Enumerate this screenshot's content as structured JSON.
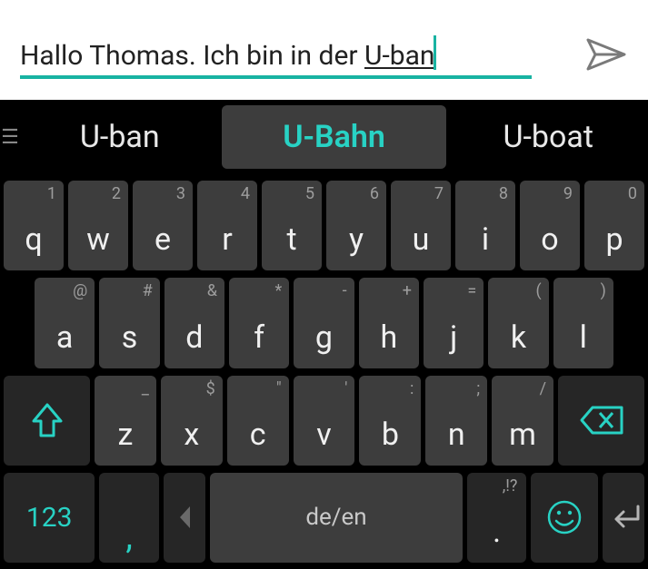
{
  "input": {
    "textBefore": "Hallo Thomas. Ich bin in der ",
    "textUnderline": "U-ban"
  },
  "suggestions": {
    "left": "U-ban",
    "center": "U-Bahn",
    "right": "U-boat"
  },
  "rows": {
    "r1": [
      {
        "main": "q",
        "sec": "1"
      },
      {
        "main": "w",
        "sec": "2"
      },
      {
        "main": "e",
        "sec": "3"
      },
      {
        "main": "r",
        "sec": "4"
      },
      {
        "main": "t",
        "sec": "5"
      },
      {
        "main": "y",
        "sec": "6"
      },
      {
        "main": "u",
        "sec": "7"
      },
      {
        "main": "i",
        "sec": "8"
      },
      {
        "main": "o",
        "sec": "9"
      },
      {
        "main": "p",
        "sec": "0"
      }
    ],
    "r2": [
      {
        "main": "a",
        "sec": "@"
      },
      {
        "main": "s",
        "sec": "#"
      },
      {
        "main": "d",
        "sec": "&"
      },
      {
        "main": "f",
        "sec": "*"
      },
      {
        "main": "g",
        "sec": "-"
      },
      {
        "main": "h",
        "sec": "+"
      },
      {
        "main": "j",
        "sec": "="
      },
      {
        "main": "k",
        "sec": "("
      },
      {
        "main": "l",
        "sec": ")"
      }
    ],
    "r3": [
      {
        "main": "z",
        "sec": "_"
      },
      {
        "main": "x",
        "sec": "$"
      },
      {
        "main": "c",
        "sec": "\""
      },
      {
        "main": "v",
        "sec": "'"
      },
      {
        "main": "b",
        "sec": ":"
      },
      {
        "main": "n",
        "sec": ";"
      },
      {
        "main": "m",
        "sec": "/"
      }
    ]
  },
  "bottom": {
    "symKey": "123",
    "comma": ",",
    "space": "de/en",
    "periodSec": ",!?",
    "period": "."
  }
}
